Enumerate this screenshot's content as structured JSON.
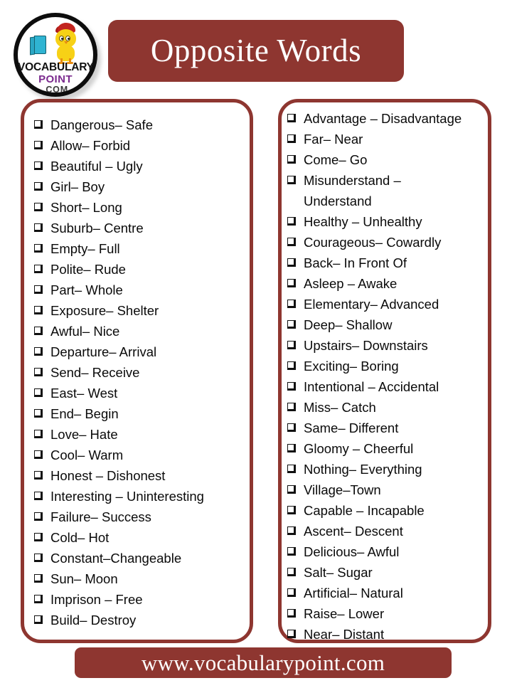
{
  "logo": {
    "line1": "VOCABULARY",
    "line2": "POINT",
    "line3": ".COM",
    "icon_names": [
      "book-icon",
      "chick-mascot-icon"
    ]
  },
  "header": {
    "title": "Opposite Words",
    "accent_color": "#8E3630"
  },
  "columns": {
    "left": {
      "items": [
        "Dangerous– Safe",
        "Allow– Forbid",
        "Beautiful – Ugly",
        "Girl– Boy",
        "Short– Long",
        "Suburb– Centre",
        "Empty– Full",
        "Polite– Rude",
        "Part– Whole",
        "Exposure– Shelter",
        "Awful– Nice",
        "Departure– Arrival",
        "Send– Receive",
        "East– West",
        "End– Begin",
        "Love– Hate",
        "Cool– Warm",
        "Honest – Dishonest",
        "Interesting – Uninteresting",
        "Failure– Success",
        "Cold– Hot",
        "Constant–Changeable",
        "Sun– Moon",
        "Imprison – Free",
        "Build– Destroy"
      ]
    },
    "right": {
      "items": [
        "Advantage – Disadvantage",
        "Far– Near",
        "Come– Go",
        "Misunderstand –\nUnderstand",
        "Healthy – Unhealthy",
        "Courageous– Cowardly",
        "Back– In Front Of",
        "Asleep – Awake",
        "Elementary– Advanced",
        "Deep– Shallow",
        "Upstairs– Downstairs",
        "Exciting– Boring",
        "Intentional – Accidental",
        "Miss– Catch",
        "Same– Different",
        "Gloomy – Cheerful",
        "Nothing– Everything",
        "Village–Town",
        "Capable – Incapable",
        "Ascent– Descent",
        "Delicious– Awful",
        "Salt– Sugar",
        "Artificial– Natural",
        "Raise– Lower",
        "Near– Distant"
      ]
    }
  },
  "footer": {
    "url": "www.vocabularypoint.com"
  }
}
